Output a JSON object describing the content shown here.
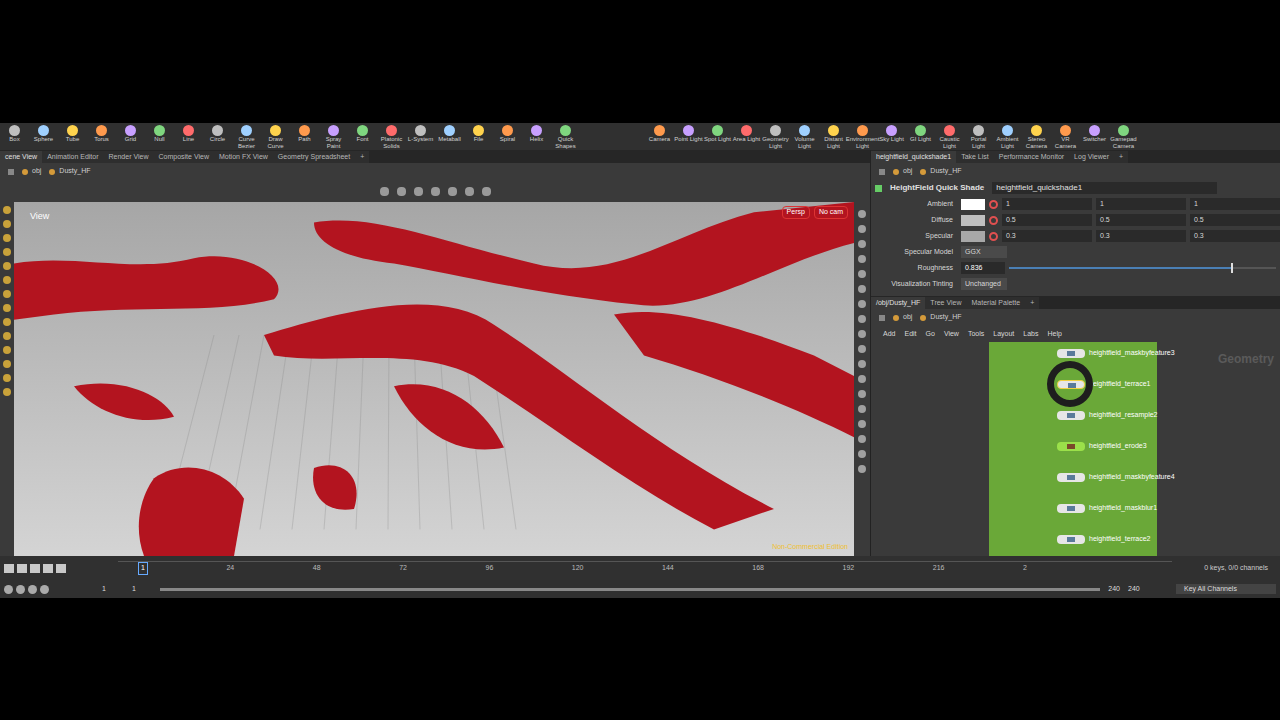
{
  "shelf": {
    "left": [
      "Box",
      "Sphere",
      "Tube",
      "Torus",
      "Grid",
      "Null",
      "Line",
      "Circle",
      "Curve Bezier",
      "Draw Curve",
      "Path",
      "Spray Paint",
      "Font",
      "Platonic Solids",
      "L-System",
      "Metaball",
      "File",
      "Spiral",
      "Helix",
      "Quick Shapes"
    ],
    "right": [
      "Camera",
      "Point Light",
      "Spot Light",
      "Area Light",
      "Geometry Light",
      "Volume Light",
      "Distant Light",
      "Environment Light",
      "Sky Light",
      "GI Light",
      "Caustic Light",
      "Portal Light",
      "Ambient Light",
      "Stereo Camera",
      "VR Camera",
      "Switcher",
      "Gamepad Camera"
    ]
  },
  "left_pane": {
    "tabs": [
      {
        "label": "cene View",
        "selected": true
      },
      {
        "label": "Animation Editor",
        "selected": false
      },
      {
        "label": "Render View",
        "selected": false
      },
      {
        "label": "Composite View",
        "selected": false
      },
      {
        "label": "Motion FX View",
        "selected": false
      },
      {
        "label": "Geometry Spreadsheet",
        "selected": false
      },
      {
        "label": "+",
        "selected": false
      }
    ],
    "path": [
      "obj",
      "Dusty_HF"
    ],
    "viewport": {
      "label": "View",
      "projection": "Persp",
      "camera": "No cam",
      "watermark": "Non-Commercial Edition"
    }
  },
  "param_pane": {
    "tabs": [
      {
        "label": "heightfield_quickshade1",
        "selected": true
      },
      {
        "label": "Take List",
        "selected": false
      },
      {
        "label": "Performance Monitor",
        "selected": false
      },
      {
        "label": "Log Viewer",
        "selected": false
      },
      {
        "label": "+",
        "selected": false
      }
    ],
    "path": [
      "obj",
      "Dusty_HF"
    ],
    "node_type": "HeightField Quick Shade",
    "node_name": "heightfield_quickshade1",
    "params": [
      {
        "label": "Ambient",
        "kind": "color",
        "color": "#ffffff",
        "values": [
          "1",
          "1",
          "1"
        ]
      },
      {
        "label": "Diffuse",
        "kind": "color",
        "color": "#bfbfbf",
        "values": [
          "0.5",
          "0.5",
          "0.5"
        ]
      },
      {
        "label": "Specular",
        "kind": "color",
        "color": "#a8a8a8",
        "values": [
          "0.3",
          "0.3",
          "0.3"
        ]
      },
      {
        "label": "Specular Model",
        "kind": "menu",
        "value": "GGX"
      },
      {
        "label": "Roughness",
        "kind": "slider",
        "value": "0.836",
        "level": 0.83
      },
      {
        "label": "Visualization Tinting",
        "kind": "menu",
        "value": "Unchanged"
      }
    ]
  },
  "network_pane": {
    "tabs": [
      {
        "label": "/obj/Dusty_HF",
        "selected": true
      },
      {
        "label": "Tree View",
        "selected": false
      },
      {
        "label": "Material Palette",
        "selected": false
      },
      {
        "label": "+",
        "selected": false
      }
    ],
    "path": [
      "obj",
      "Dusty_HF"
    ],
    "menu": [
      "Add",
      "Edit",
      "Go",
      "View",
      "Tools",
      "Layout",
      "Labs",
      "Help"
    ],
    "context": "Geometry",
    "nodes": [
      {
        "name": "heightfield_maskbyfeature3",
        "selected": false,
        "flagged": false
      },
      {
        "name": "heightfield_terrace1",
        "selected": true,
        "flagged": false
      },
      {
        "name": "heightfield_resample2",
        "selected": false,
        "flagged": false
      },
      {
        "name": "heightfield_erode3",
        "selected": false,
        "flagged": true
      },
      {
        "name": "heightfield_maskbyfeature4",
        "selected": false,
        "flagged": false
      },
      {
        "name": "heightfield_maskblur1",
        "selected": false,
        "flagged": false
      },
      {
        "name": "heightfield_terrace2",
        "selected": false,
        "flagged": false
      }
    ]
  },
  "timeline": {
    "current_frame": "1",
    "ticks": [
      "24",
      "48",
      "72",
      "96",
      "120",
      "144",
      "168",
      "192",
      "216",
      "2"
    ],
    "start": "1",
    "start2": "1",
    "end": "240",
    "end2": "240",
    "keys": "0 keys, 0/0 channels",
    "key_button": "Key All Channels"
  }
}
